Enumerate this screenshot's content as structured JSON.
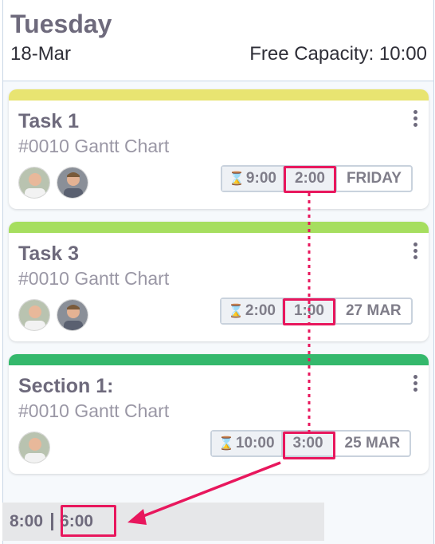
{
  "day": {
    "title": "Tuesday",
    "date": "18-Mar",
    "free_capacity": "Free Capacity: 10:00"
  },
  "cards": [
    {
      "title": "Task 1",
      "subtitle": "#0010 Gantt Chart",
      "bar_color": "#e8e471",
      "estimate": "9:00",
      "allocated": "2:00",
      "due": "FRIDAY"
    },
    {
      "title": "Task 3",
      "subtitle": "#0010 Gantt Chart",
      "bar_color": "#a6de5f",
      "estimate": "2:00",
      "allocated": "1:00",
      "due": "27 MAR"
    },
    {
      "title": "Section 1:",
      "subtitle": "#0010 Gantt Chart",
      "bar_color": "#34b86c",
      "estimate": "10:00",
      "allocated": "3:00",
      "due": "25 MAR"
    }
  ],
  "footer": {
    "total": "8:00",
    "remaining": "6:00"
  },
  "colors": {
    "highlight": "#e8175d"
  }
}
